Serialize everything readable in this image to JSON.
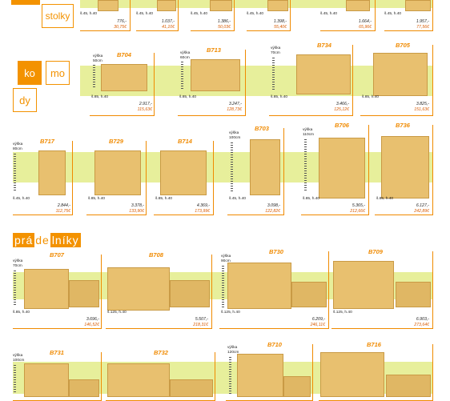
{
  "colors": {
    "accent": "#f39200",
    "band": "#e7ef9b",
    "wood": "#e8c06f",
    "wood_dark": "#c99a45"
  },
  "headers": {
    "stolky": "stolky",
    "komody": {
      "ko": "ko",
      "mo": "mo",
      "dy": "dy"
    },
    "pradelniky": {
      "pra": "prá",
      "de": "de",
      "lniky": "lníky"
    }
  },
  "vyska": {
    "label": "výška",
    "h50": "50cm",
    "h60": "60cm",
    "h70": "70cm",
    "h80": "80cm",
    "h90": "90cm",
    "h100": "100cm",
    "h110": "110cm",
    "h120": "120cm"
  },
  "top_row": [
    {
      "dim": "š.45, h.40",
      "price": "776,-",
      "eur": "30,75€"
    },
    {
      "dim": "š.45, h.40",
      "price": "1.037,-",
      "eur": "41,10€"
    },
    {
      "dim": "š.45, h.40",
      "price": "1.386,-",
      "eur": "50,03€"
    },
    {
      "dim": "š.45, h.40",
      "price": "1.398,-",
      "eur": "55,40€"
    },
    {
      "dim": "š.45, h.40",
      "price": "1.664,-",
      "eur": "65,96€"
    },
    {
      "dim": "š.45, h.40",
      "price": "1.957,-",
      "eur": "77,56€"
    }
  ],
  "row2": [
    {
      "code": "B704",
      "dim": "š.85, h.40",
      "price": "2.917,-",
      "eur": "115,63€"
    },
    {
      "code": "B713",
      "dim": "š.85, h.40",
      "price": "3.247,-",
      "eur": "128,73€"
    },
    {
      "code": "B734",
      "dim": "š.85, h.40",
      "price": "3.466,-",
      "eur": "125,12€"
    },
    {
      "code": "B705",
      "dim": "š.85, h.40",
      "price": "3.825,-",
      "eur": "151,63€"
    }
  ],
  "row3": [
    {
      "code": "B717",
      "dim": "š.45, h.40",
      "price": "2.844,-",
      "eur": "112,75€"
    },
    {
      "code": "B729",
      "dim": "š.85, h.40",
      "price": "3.378,-",
      "eur": "133,90€"
    },
    {
      "code": "B714",
      "dim": "š.85, h.40",
      "price": "4.369,-",
      "eur": "173,99€"
    },
    {
      "code": "B703",
      "dim": "š.45, h.40",
      "price": "3.098,-",
      "eur": "122,82€"
    },
    {
      "code": "B706",
      "dim": "š.85, h.40",
      "price": "5.365,-",
      "eur": "212,66€"
    },
    {
      "code": "B736",
      "dim": "š.85, h.40",
      "price": "6.127,-",
      "eur": "242,89€"
    }
  ],
  "row4": [
    {
      "code": "B707",
      "dim": "š.85, h.40",
      "price": "3.696,-",
      "eur": "146,52€"
    },
    {
      "code": "B708",
      "dim": "š.125, h.40",
      "price": "5.507,-",
      "eur": "218,31€"
    },
    {
      "code": "B730",
      "dim": "š.125, h.40",
      "price": "6.209,-",
      "eur": "246,11€"
    },
    {
      "code": "B709",
      "dim": "š.125, h.40",
      "price": "6.903,-",
      "eur": "273,64€"
    }
  ],
  "row5": [
    {
      "code": "B731"
    },
    {
      "code": "B732"
    },
    {
      "code": "B710"
    },
    {
      "code": "B716"
    }
  ]
}
